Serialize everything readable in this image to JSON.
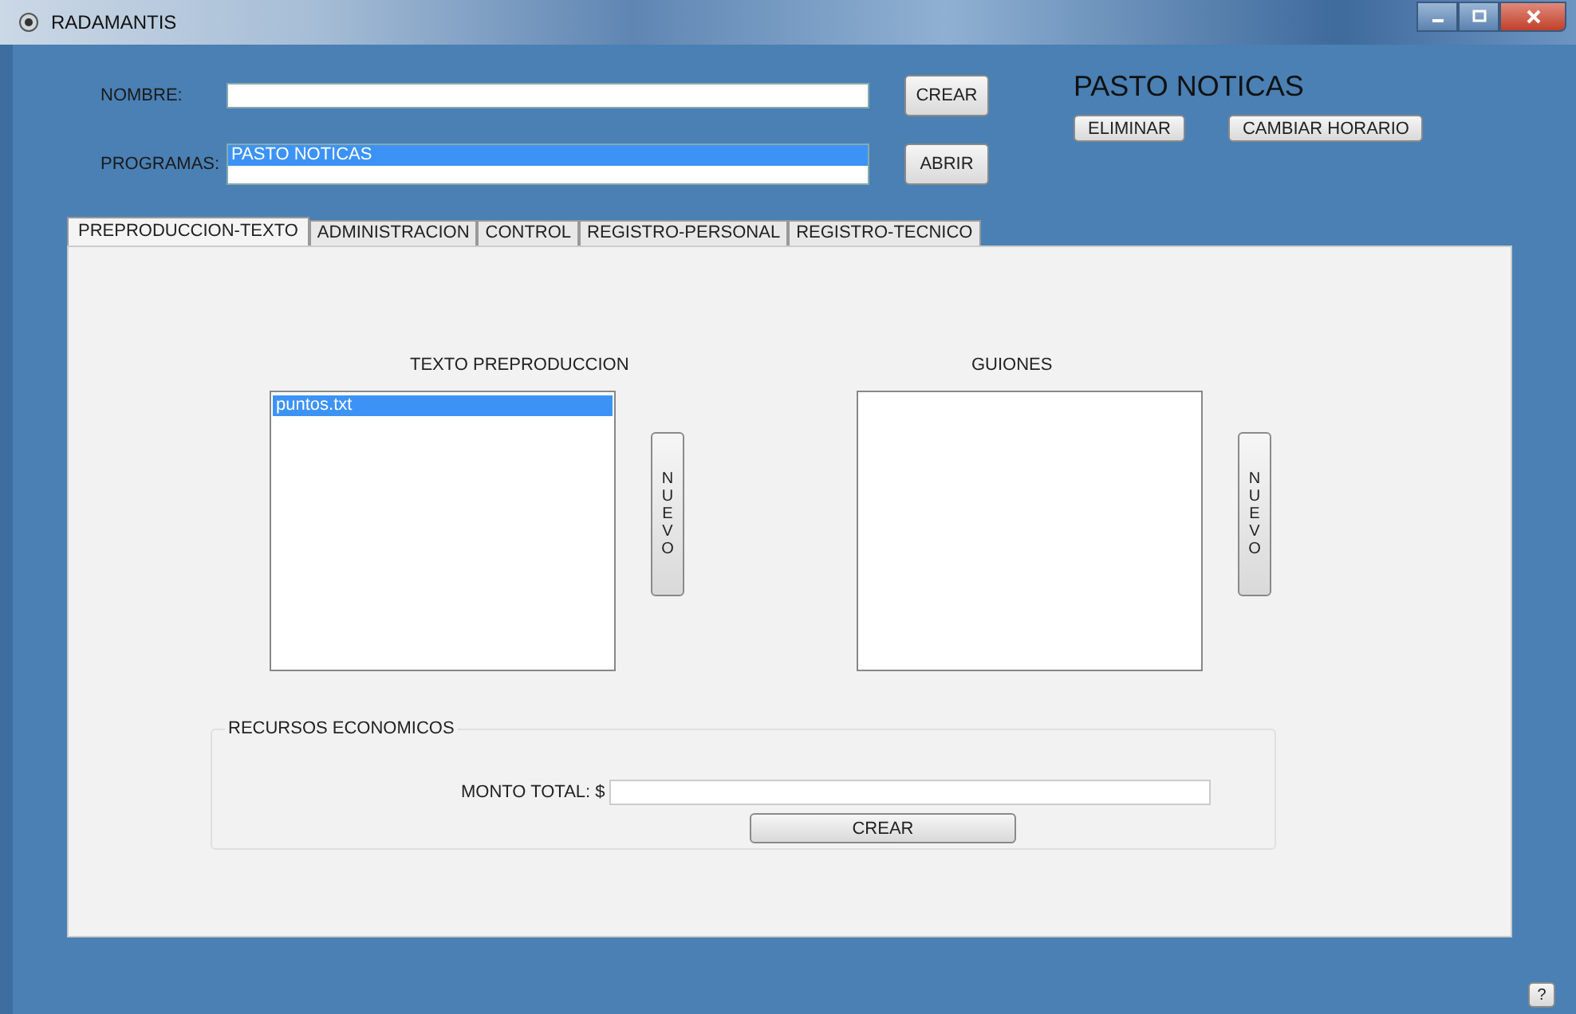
{
  "window": {
    "title": "RADAMANTIS"
  },
  "form": {
    "nombre": {
      "label": "NOMBRE:"
    },
    "crear_button": "CREAR",
    "programas": {
      "label": "PROGRAMAS:",
      "items": [
        {
          "text": "PASTO NOTICAS",
          "selected": true
        }
      ]
    },
    "abrir_button": "ABRIR"
  },
  "program": {
    "title": "PASTO NOTICAS",
    "buttons": [
      "ELIMINAR",
      "CAMBIAR HORARIO"
    ]
  },
  "tabs": [
    {
      "label": "PREPRODUCCION-TEXTO",
      "selected": true
    },
    {
      "label": "ADMINISTRACION",
      "selected": false
    },
    {
      "label": "CONTROL",
      "selected": false
    },
    {
      "label": "REGISTRO-PERSONAL",
      "selected": false
    },
    {
      "label": "REGISTRO-TECNICO",
      "selected": false
    }
  ],
  "panel": {
    "lists": [
      {
        "title": "TEXTO PREPRODUCCION",
        "items": [
          {
            "text": "puntos.txt",
            "selected": true
          }
        ],
        "button": "NUEVO"
      },
      {
        "title": "GUIONES",
        "button": "NUEVO"
      }
    ],
    "resources": {
      "legend": "RECURSOS ECONOMICOS",
      "label": "MONTO TOTAL: $",
      "button": "CREAR"
    }
  },
  "help_button": "?"
}
